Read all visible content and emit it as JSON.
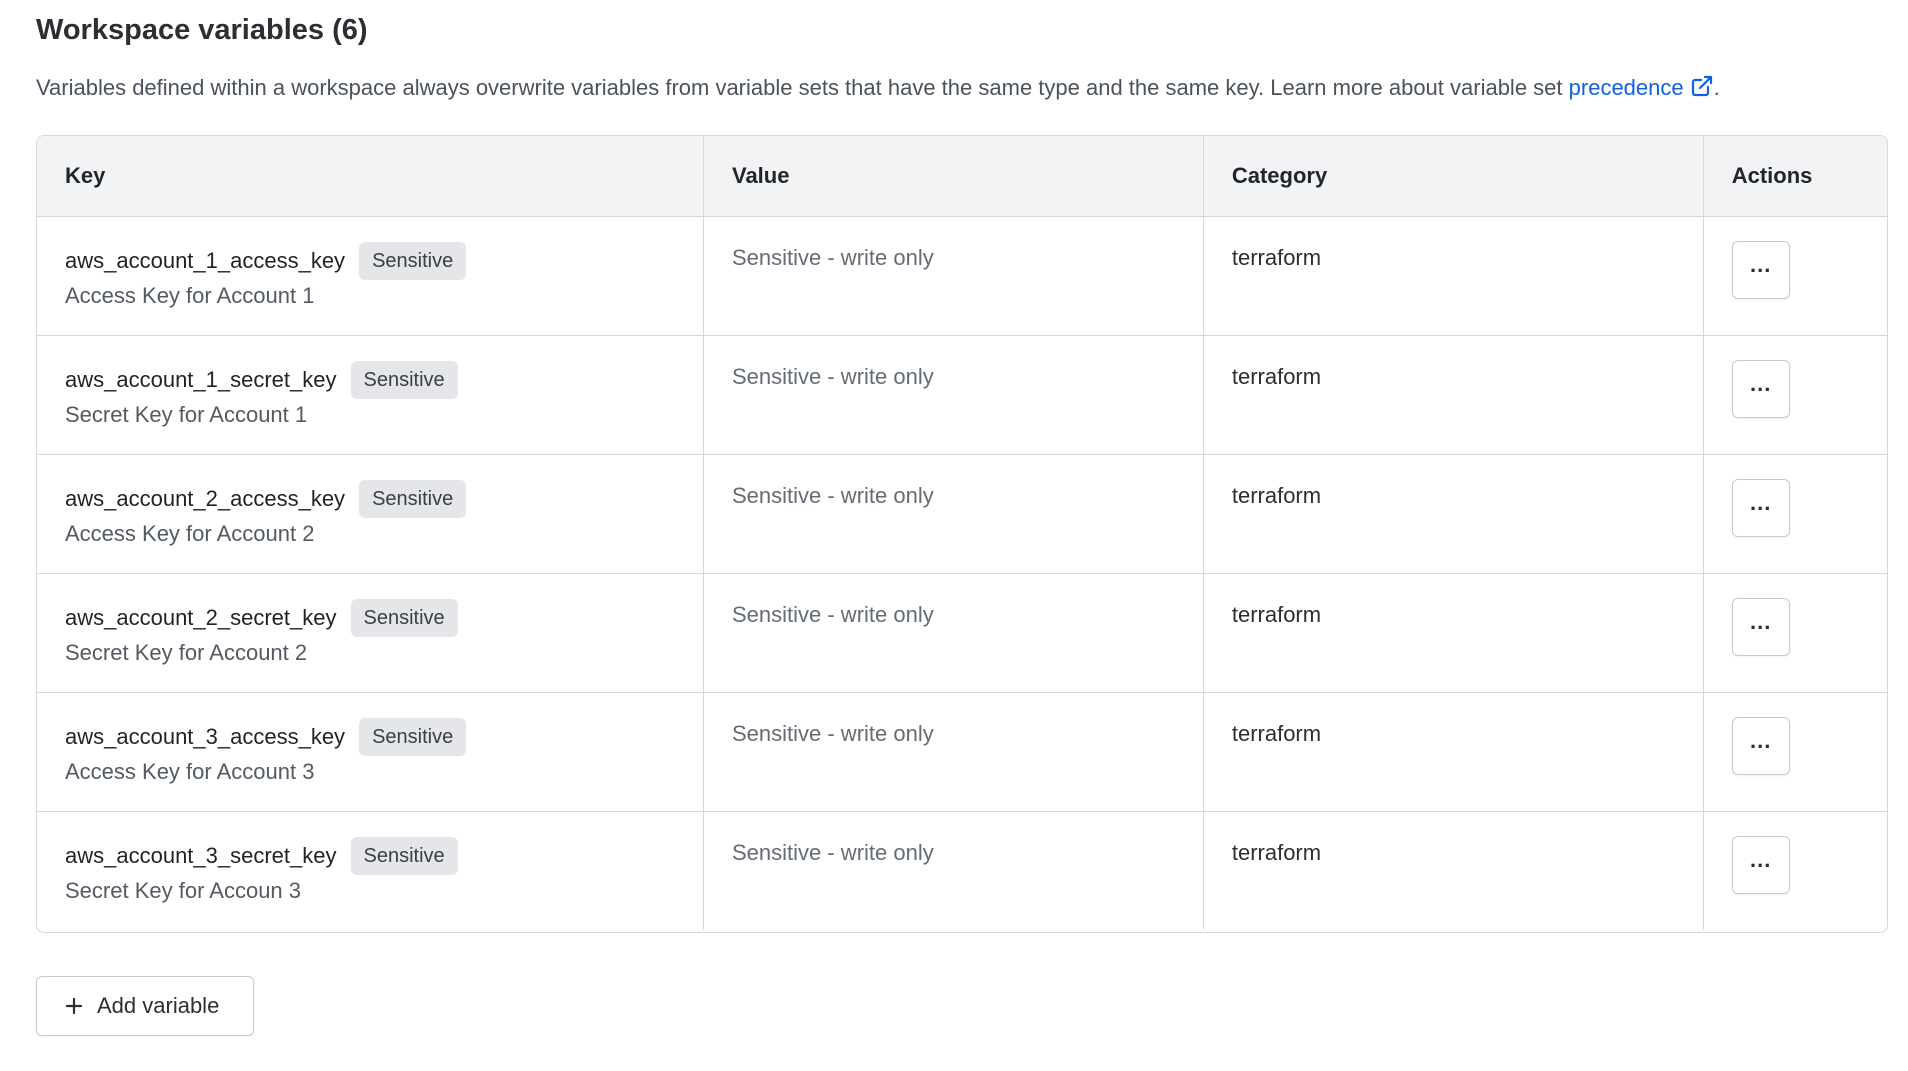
{
  "header": {
    "title": "Workspace variables (6)",
    "description": "Variables defined within a workspace always overwrite variables from variable sets that have the same type and the same key. Learn more about variable set ",
    "link_text": "precedence",
    "trailing": "."
  },
  "table": {
    "columns": {
      "key": "Key",
      "value": "Value",
      "category": "Category",
      "actions": "Actions"
    },
    "rows": [
      {
        "key": "aws_account_1_access_key",
        "badge": "Sensitive",
        "description": "Access Key for Account 1",
        "value": "Sensitive - write only",
        "category": "terraform",
        "actions_label": "..."
      },
      {
        "key": "aws_account_1_secret_key",
        "badge": "Sensitive",
        "description": "Secret Key for Account 1",
        "value": "Sensitive - write only",
        "category": "terraform",
        "actions_label": "..."
      },
      {
        "key": "aws_account_2_access_key",
        "badge": "Sensitive",
        "description": "Access Key for Account 2",
        "value": "Sensitive - write only",
        "category": "terraform",
        "actions_label": "..."
      },
      {
        "key": "aws_account_2_secret_key",
        "badge": "Sensitive",
        "description": "Secret Key for Account 2",
        "value": "Sensitive - write only",
        "category": "terraform",
        "actions_label": "..."
      },
      {
        "key": "aws_account_3_access_key",
        "badge": "Sensitive",
        "description": "Access Key for Account 3",
        "value": "Sensitive - write only",
        "category": "terraform",
        "actions_label": "..."
      },
      {
        "key": "aws_account_3_secret_key",
        "badge": "Sensitive",
        "description": "Secret Key for Accoun 3",
        "value": "Sensitive - write only",
        "category": "terraform",
        "actions_label": "..."
      }
    ]
  },
  "add_button": {
    "label": "Add variable",
    "icon": "plus-icon"
  },
  "icons": {
    "external_link": "external-link-icon"
  },
  "colors": {
    "link": "#1060e6",
    "header_bg": "#f2f3f5",
    "badge_bg": "#e4e6ea",
    "border": "#d5d8dd"
  }
}
